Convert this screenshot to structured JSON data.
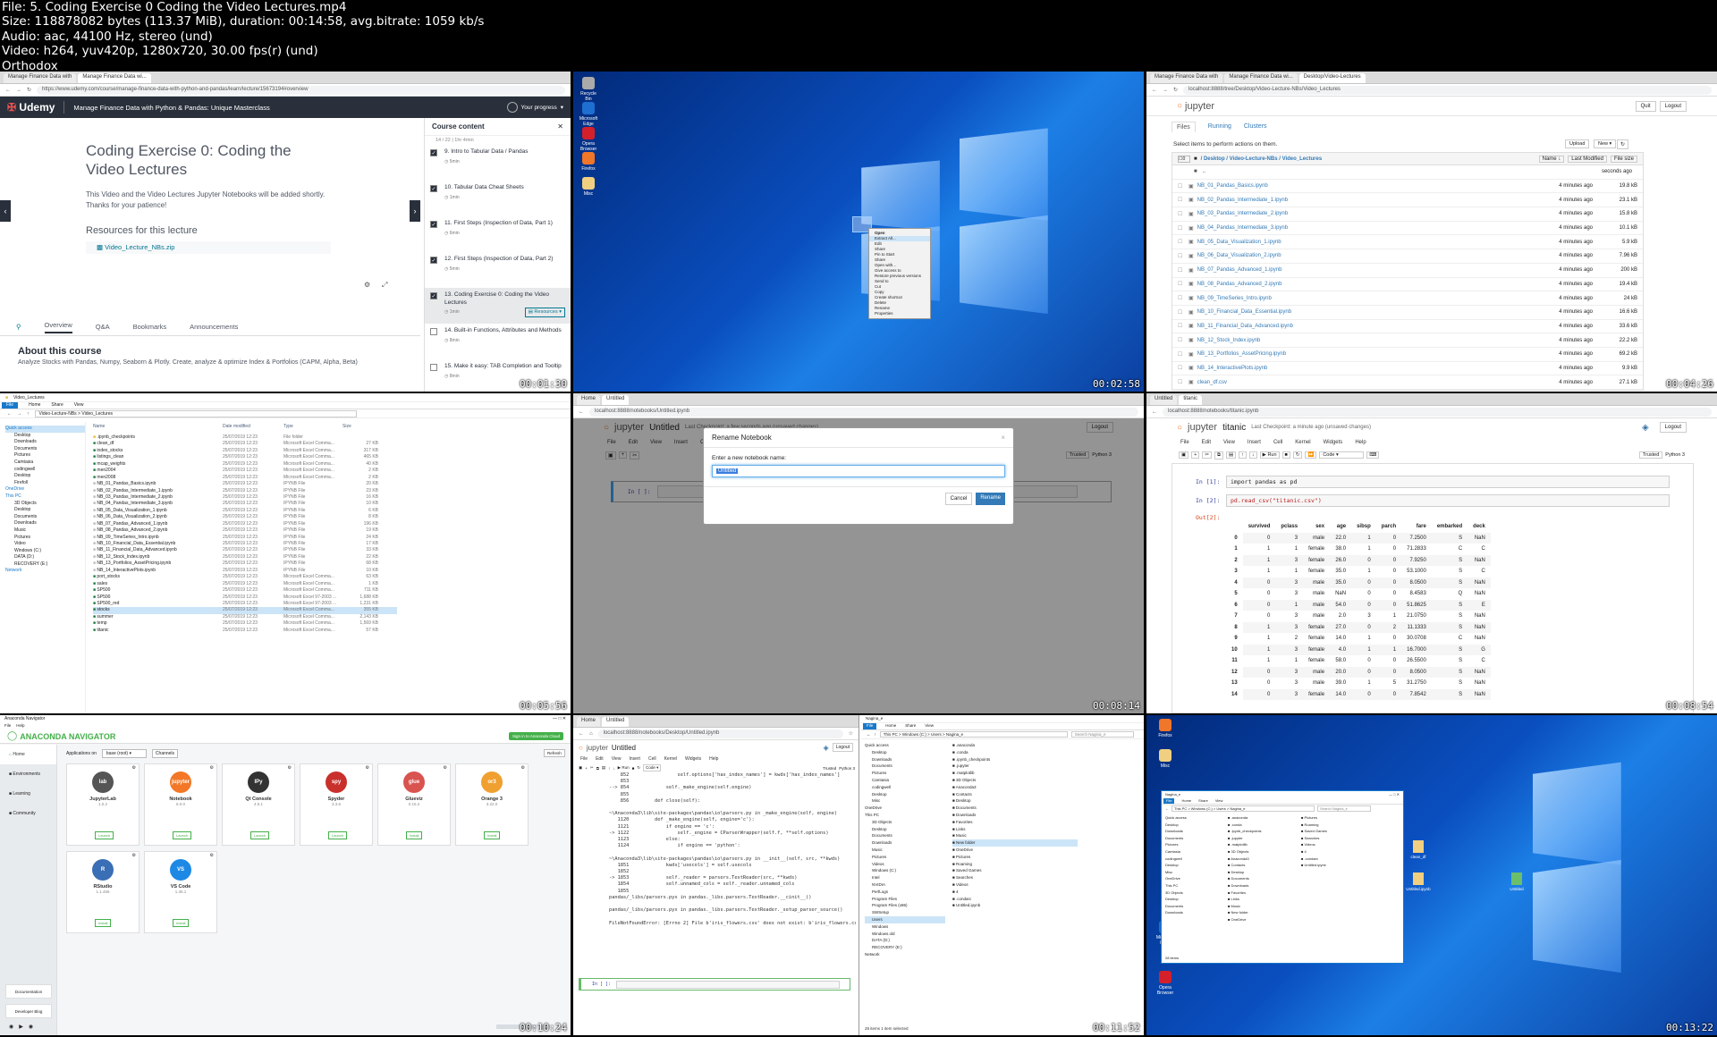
{
  "header": {
    "file": "File: 5. Coding Exercise 0 Coding the Video Lectures.mp4",
    "size": "Size: 118878082 bytes (113.37 MiB), duration: 00:14:58, avg.bitrate: 1059 kb/s",
    "audio": "Audio: aac, 44100 Hz, stereo (und)",
    "video": "Video: h264, yuv420p, 1280x720, 30.00 fps(r) (und)",
    "label": "Orthodox"
  },
  "timestamps": [
    "00:01:30",
    "00:02:58",
    "00:04:26",
    "00:05:56",
    "00:08:14",
    "00:08:54",
    "00:10:24",
    "00:11:52",
    "00:13:22"
  ],
  "udemy": {
    "tab1": "Manage Finance Data with",
    "tab2": "Manage Finance Data wi...",
    "url": "https://www.udemy.com/course/manage-finance-data-with-python-and-pandas/learn/lecture/15673194#overview",
    "logo": "Udemy",
    "course_title": "Manage Finance Data with Python & Pandas: Unique Masterclass",
    "progress": "Your progress",
    "lecture_title": "Coding Exercise 0: Coding the Video Lectures",
    "lecture_body": "This Video and the Video Lectures Jupyter Notebooks will be added shortly. Thanks for your patience!",
    "resources_heading": "Resources for this lecture",
    "resource_file": "Video_Lecture_NBs.zip",
    "tabs": [
      "Overview",
      "Q&A",
      "Bookmarks",
      "Announcements"
    ],
    "about_heading": "About this course",
    "about_body": "Analyze Stocks with Pandas, Numpy, Seaborn & Plotly. Create, analyze & optimize Index & Portfolios (CAPM, Alpha, Beta)",
    "sidebar_title": "Course content",
    "sidebar_top": "14 / 22 | 1hr 4min",
    "items": [
      {
        "label": "9. Intro to Tabular Data / Pandas",
        "dur": "5min",
        "checked": true
      },
      {
        "label": "10. Tabular Data Cheat Sheets",
        "dur": "1min",
        "checked": true
      },
      {
        "label": "11. First Steps (Inspection of Data, Part 1)",
        "dur": "6min",
        "checked": true
      },
      {
        "label": "12. First Steps (Inspection of Data, Part 2)",
        "dur": "5min",
        "checked": true
      },
      {
        "label": "13. Coding Exercise 0: Coding the Video Lectures",
        "dur": "1min",
        "checked": true
      },
      {
        "label": "14. Built-in Functions, Attributes and Methods",
        "dur": "8min",
        "checked": false
      },
      {
        "label": "15. Make it easy: TAB Completion and Tooltip",
        "dur": "8min",
        "checked": false
      }
    ],
    "resources_btn": "Resources"
  },
  "desktop1": {
    "icons": [
      "Recycle Bin",
      "Microsoft Edge",
      "Opera Browser",
      "Firefox",
      "Misc"
    ],
    "menu": [
      "Open",
      "Extract All...",
      "Edit",
      "Share",
      "Pin to Start",
      "Share",
      "Open with...",
      "Give access to",
      "Restore previous versions",
      "Send to",
      "Cut",
      "Copy",
      "Create shortcut",
      "Delete",
      "Rename",
      "Properties"
    ]
  },
  "jupyter_tree": {
    "tab": "Desktop/Video-Lectures",
    "url": "localhost:8888/tree/Desktop/Video-Lecture-NBs/Video_Lectures",
    "logo": "jupyter",
    "quit": "Quit",
    "logout": "Logout",
    "tabs": [
      "Files",
      "Running",
      "Clusters"
    ],
    "instructions": "Select items to perform actions on them.",
    "upload": "Upload",
    "new": "New",
    "breadcrumb": [
      "Desktop",
      "Video-Lecture-NBs",
      "Video_Lectures"
    ],
    "name_col": "Name",
    "modified_col": "Last Modified",
    "size_col": "File size",
    "parent": "..",
    "parent_time": "seconds ago",
    "files": [
      {
        "name": "NB_01_Pandas_Basics.ipynb",
        "time": "4 minutes ago",
        "size": "19.8 kB"
      },
      {
        "name": "NB_02_Pandas_Intermediate_1.ipynb",
        "time": "4 minutes ago",
        "size": "23.1 kB"
      },
      {
        "name": "NB_03_Pandas_Intermediate_2.ipynb",
        "time": "4 minutes ago",
        "size": "15.8 kB"
      },
      {
        "name": "NB_04_Pandas_Intermediate_3.ipynb",
        "time": "4 minutes ago",
        "size": "10.1 kB"
      },
      {
        "name": "NB_05_Data_Visualization_1.ipynb",
        "time": "4 minutes ago",
        "size": "5.9 kB"
      },
      {
        "name": "NB_06_Data_Visualization_2.ipynb",
        "time": "4 minutes ago",
        "size": "7.96 kB"
      },
      {
        "name": "NB_07_Pandas_Advanced_1.ipynb",
        "time": "4 minutes ago",
        "size": "200 kB"
      },
      {
        "name": "NB_08_Pandas_Advanced_2.ipynb",
        "time": "4 minutes ago",
        "size": "19.4 kB"
      },
      {
        "name": "NB_09_TimeSeries_Intro.ipynb",
        "time": "4 minutes ago",
        "size": "24 kB"
      },
      {
        "name": "NB_10_Financial_Data_Essential.ipynb",
        "time": "4 minutes ago",
        "size": "16.6 kB"
      },
      {
        "name": "NB_11_Financial_Data_Advanced.ipynb",
        "time": "4 minutes ago",
        "size": "33.6 kB"
      },
      {
        "name": "NB_12_Stock_Index.ipynb",
        "time": "4 minutes ago",
        "size": "22.2 kB"
      },
      {
        "name": "NB_13_Portfolios_AssetPricing.ipynb",
        "time": "4 minutes ago",
        "size": "69.2 kB"
      },
      {
        "name": "NB_14_InteractivePlots.ipynb",
        "time": "4 minutes ago",
        "size": "9.9 kB"
      },
      {
        "name": "clean_df.csv",
        "time": "4 minutes ago",
        "size": "27.1 kB"
      }
    ]
  },
  "explorer": {
    "title": "Video_Lectures",
    "menu": [
      "File",
      "Home",
      "Share",
      "View"
    ],
    "path": "Video-Lecture-NBs > Video_Lectures",
    "cols": [
      "Name",
      "Date modified",
      "Type",
      "Size"
    ],
    "nav": [
      "Quick access",
      "Desktop",
      "Downloads",
      "Documents",
      "Pictures",
      "Camtasia",
      "codingwell",
      "Desktop",
      "Firefoll",
      "OneDrive",
      "This PC",
      "3D Objects",
      "Desktop",
      "Documents",
      "Downloads",
      "Music",
      "Pictures",
      "Video",
      "Windows (C:)",
      "DATA (D:)",
      "RECOVERY (E:)",
      "Network"
    ],
    "rows": [
      {
        "n": ".ipynb_checkpoints",
        "d": "25/07/2019 12:23",
        "t": "File folder",
        "s": ""
      },
      {
        "n": "clean_df",
        "d": "25/07/2019 12:23",
        "t": "Microsoft Excel Comma...",
        "s": "27 KB"
      },
      {
        "n": "index_stocks",
        "d": "25/07/2019 12:23",
        "t": "Microsoft Excel Comma...",
        "s": "317 KB"
      },
      {
        "n": "listings_clean",
        "d": "25/07/2019 12:23",
        "t": "Microsoft Excel Comma...",
        "s": "465 KB"
      },
      {
        "n": "mcap_weights",
        "d": "25/07/2019 12:23",
        "t": "Microsoft Excel Comma...",
        "s": "40 KB"
      },
      {
        "n": "men2004",
        "d": "25/07/2019 12:23",
        "t": "Microsoft Excel Comma...",
        "s": "2 KB"
      },
      {
        "n": "men2008",
        "d": "25/07/2019 12:23",
        "t": "Microsoft Excel Comma...",
        "s": "2 KB"
      },
      {
        "n": "NB_01_Pandas_Basics.ipynb",
        "d": "25/07/2019 12:23",
        "t": "IPYNB File",
        "s": "20 KB"
      },
      {
        "n": "NB_02_Pandas_Intermediate_1.ipynb",
        "d": "25/07/2019 12:23",
        "t": "IPYNB File",
        "s": "23 KB"
      },
      {
        "n": "NB_03_Pandas_Intermediate_2.ipynb",
        "d": "25/07/2019 12:23",
        "t": "IPYNB File",
        "s": "16 KB"
      },
      {
        "n": "NB_04_Pandas_Intermediate_3.ipynb",
        "d": "25/07/2019 12:23",
        "t": "IPYNB File",
        "s": "10 KB"
      },
      {
        "n": "NB_05_Data_Visualization_1.ipynb",
        "d": "25/07/2019 12:23",
        "t": "IPYNB File",
        "s": "6 KB"
      },
      {
        "n": "NB_06_Data_Visualization_2.ipynb",
        "d": "25/07/2019 12:23",
        "t": "IPYNB File",
        "s": "8 KB"
      },
      {
        "n": "NB_07_Pandas_Advanced_1.ipynb",
        "d": "25/07/2019 12:23",
        "t": "IPYNB File",
        "s": "196 KB"
      },
      {
        "n": "NB_08_Pandas_Advanced_2.ipynb",
        "d": "25/07/2019 12:23",
        "t": "IPYNB File",
        "s": "19 KB"
      },
      {
        "n": "NB_09_TimeSeries_Intro.ipynb",
        "d": "25/07/2019 12:23",
        "t": "IPYNB File",
        "s": "24 KB"
      },
      {
        "n": "NB_10_Financial_Data_Essential.ipynb",
        "d": "25/07/2019 12:23",
        "t": "IPYNB File",
        "s": "17 KB"
      },
      {
        "n": "NB_11_Financial_Data_Advanced.ipynb",
        "d": "25/07/2019 12:23",
        "t": "IPYNB File",
        "s": "33 KB"
      },
      {
        "n": "NB_12_Stock_Index.ipynb",
        "d": "25/07/2019 12:23",
        "t": "IPYNB File",
        "s": "22 KB"
      },
      {
        "n": "NB_13_Portfolios_AssetPricing.ipynb",
        "d": "25/07/2019 12:23",
        "t": "IPYNB File",
        "s": "68 KB"
      },
      {
        "n": "NB_14_InteractivePlots.ipynb",
        "d": "25/07/2019 12:23",
        "t": "IPYNB File",
        "s": "10 KB"
      },
      {
        "n": "port_stocks",
        "d": "25/07/2019 12:23",
        "t": "Microsoft Excel Comma...",
        "s": "63 KB"
      },
      {
        "n": "sales",
        "d": "25/07/2019 12:23",
        "t": "Microsoft Excel Comma...",
        "s": "1 KB"
      },
      {
        "n": "SP500",
        "d": "25/07/2019 12:23",
        "t": "Microsoft Excel Comma...",
        "s": "711 KB"
      },
      {
        "n": "SP500",
        "d": "25/07/2019 12:23",
        "t": "Microsoft Excel 97-2003 ...",
        "s": "1,688 KB"
      },
      {
        "n": "SP500_red",
        "d": "25/07/2019 12:23",
        "t": "Microsoft Excel 97-2003 ...",
        "s": "1,231 KB"
      },
      {
        "n": "stocks",
        "d": "25/07/2019 12:23",
        "t": "Microsoft Excel Comma...",
        "s": "355 KB"
      },
      {
        "n": "summer",
        "d": "25/07/2019 12:23",
        "t": "Microsoft Excel Comma...",
        "s": "2,143 KB"
      },
      {
        "n": "temp",
        "d": "25/07/2019 12:23",
        "t": "Microsoft Excel Comma...",
        "s": "1,569 KB"
      },
      {
        "n": "titanic",
        "d": "25/07/2019 12:23",
        "t": "Microsoft Excel Comma...",
        "s": "57 KB"
      }
    ]
  },
  "rename": {
    "tab1": "Untitled",
    "tab2": "Home",
    "logo": "jupyter",
    "nb_name": "Untitled",
    "checkpoint": "Last Checkpoint: a few seconds ago (unsaved changes)",
    "logout": "Logout",
    "menu": [
      "File",
      "Edit",
      "View",
      "Insert",
      "Cell",
      "Kernel",
      "Widgets",
      "Help"
    ],
    "trusted": "Trusted",
    "kernel": "Python 3",
    "prompt": "In [ ]:",
    "dialog_title": "Rename Notebook",
    "dialog_label": "Enter a new notebook name:",
    "dialog_value": "Untitled",
    "cancel": "Cancel",
    "rename": "Rename"
  },
  "titanic_nb": {
    "tab1": "Untitled",
    "tab2": "titanic",
    "logo": "jupyter",
    "nb_name": "titanic",
    "checkpoint": "Last Checkpoint: a minute ago (unsaved changes)",
    "logout": "Logout",
    "menu": [
      "File",
      "Edit",
      "View",
      "Insert",
      "Cell",
      "Kernel",
      "Widgets",
      "Help"
    ],
    "trusted": "Trusted",
    "kernel": "Python 3",
    "run": "Run",
    "celltype": "Code",
    "in1": "In [1]:",
    "code1": "import pandas as pd",
    "in2": "In [2]:",
    "code2": "pd.read_csv(\"titanic.csv\")",
    "out2": "Out[2]:",
    "columns": [
      "survived",
      "pclass",
      "sex",
      "age",
      "sibsp",
      "parch",
      "fare",
      "embarked",
      "deck"
    ],
    "rows": [
      [
        "0",
        "0",
        "3",
        "male",
        "22.0",
        "1",
        "0",
        "7.2500",
        "S",
        "NaN"
      ],
      [
        "1",
        "1",
        "1",
        "female",
        "38.0",
        "1",
        "0",
        "71.2833",
        "C",
        "C"
      ],
      [
        "2",
        "1",
        "3",
        "female",
        "26.0",
        "0",
        "0",
        "7.9250",
        "S",
        "NaN"
      ],
      [
        "3",
        "1",
        "1",
        "female",
        "35.0",
        "1",
        "0",
        "53.1000",
        "S",
        "C"
      ],
      [
        "4",
        "0",
        "3",
        "male",
        "35.0",
        "0",
        "0",
        "8.0500",
        "S",
        "NaN"
      ],
      [
        "5",
        "0",
        "3",
        "male",
        "NaN",
        "0",
        "0",
        "8.4583",
        "Q",
        "NaN"
      ],
      [
        "6",
        "0",
        "1",
        "male",
        "54.0",
        "0",
        "0",
        "51.8625",
        "S",
        "E"
      ],
      [
        "7",
        "0",
        "3",
        "male",
        "2.0",
        "3",
        "1",
        "21.0750",
        "S",
        "NaN"
      ],
      [
        "8",
        "1",
        "3",
        "female",
        "27.0",
        "0",
        "2",
        "11.1333",
        "S",
        "NaN"
      ],
      [
        "9",
        "1",
        "2",
        "female",
        "14.0",
        "1",
        "0",
        "30.0708",
        "C",
        "NaN"
      ],
      [
        "10",
        "1",
        "3",
        "female",
        "4.0",
        "1",
        "1",
        "16.7000",
        "S",
        "G"
      ],
      [
        "11",
        "1",
        "1",
        "female",
        "58.0",
        "0",
        "0",
        "26.5500",
        "S",
        "C"
      ],
      [
        "12",
        "0",
        "3",
        "male",
        "20.0",
        "0",
        "0",
        "8.0500",
        "S",
        "NaN"
      ],
      [
        "13",
        "0",
        "3",
        "male",
        "39.0",
        "1",
        "5",
        "31.2750",
        "S",
        "NaN"
      ],
      [
        "14",
        "0",
        "3",
        "female",
        "14.0",
        "0",
        "0",
        "7.8542",
        "S",
        "NaN"
      ]
    ]
  },
  "anaconda": {
    "title": "Anaconda Navigator",
    "menu": [
      "File",
      "Help"
    ],
    "logo": "ANACONDA NAVIGATOR",
    "signin": "Sign in to Anaconda Cloud",
    "nav": [
      "Home",
      "Environments",
      "Learning",
      "Community"
    ],
    "apps_on": "Applications on",
    "env": "base (root)",
    "channels": "Channels",
    "refresh": "Refresh",
    "cards": [
      {
        "name": "JupyterLab",
        "ver": "1.0.2",
        "btn": "Launch",
        "mark": "lab"
      },
      {
        "name": "Notebook",
        "ver": "6.0.0",
        "btn": "Launch",
        "mark": "jupyter"
      },
      {
        "name": "Qt Console",
        "ver": "4.5.1",
        "btn": "Launch",
        "mark": "IPy"
      },
      {
        "name": "Spyder",
        "ver": "3.3.6",
        "btn": "Launch",
        "mark": "spy"
      },
      {
        "name": "Glueviz",
        "ver": "0.15.2",
        "btn": "Install",
        "mark": "glue"
      },
      {
        "name": "Orange 3",
        "ver": "3.22.0",
        "btn": "Install",
        "mark": "or3"
      },
      {
        "name": "RStudio",
        "ver": "1.1.456",
        "btn": "Install",
        "mark": "R"
      },
      {
        "name": "VS Code",
        "ver": "1.36.1",
        "btn": "Install",
        "mark": "VS"
      }
    ],
    "side_links": [
      "Documentation",
      "Developer Blog"
    ]
  },
  "error_nb": {
    "tab1": "Home",
    "tab2": "Untitled",
    "url": "localhost:8888/notebooks/Desktop/Untitled.ipynb",
    "logo": "jupyter",
    "nb_name": "Untitled",
    "logout": "Logout",
    "trusted": "Trusted",
    "kernel": "Python 3",
    "run": "Run",
    "celltype": "Code",
    "traceback": "    852                 self.options['has_index_names'] = kwds['has_index_names']\n    853 \n--> 854             self._make_engine(self.engine)\n    855 \n    856         def close(self):\n\n~\\Anaconda3\\lib\\site-packages\\pandas\\io\\parsers.py in _make_engine(self, engine)\n   1120         def _make_engine(self, engine='c'):\n   1121             if engine == 'c':\n-> 1122                 self._engine = CParserWrapper(self.f, **self.options)\n   1123             else:\n   1124                 if engine == 'python':\n\n~\\Anaconda3\\lib\\site-packages\\pandas\\io\\parsers.py in __init__(self, src, **kwds)\n   1851             kwds['usecols'] = self.usecols\n   1852 \n-> 1853             self._reader = parsers.TextReader(src, **kwds)\n   1854             self.unnamed_cols = self._reader.unnamed_cols\n   1855 \npandas/_libs/parsers.pyx in pandas._libs.parsers.TextReader.__cinit__()\n\npandas/_libs/parsers.pyx in pandas._libs.parsers.TextReader._setup_parser_source()\n\nFileNotFoundError: [Errno 2] File b'iris_flowers.csv' does not exist: b'iris_flowers.csv'",
    "prompt": "In [ ]:"
  },
  "explorer2": {
    "title": "Nagina_e",
    "menu": [
      "File",
      "Home",
      "Share",
      "View"
    ],
    "path": "This PC > Windows (C:) > Users > Nagina_e",
    "search": "Search Nagina_e",
    "nav": [
      "Quick access",
      "Desktop",
      "Downloads",
      "Documents",
      "Pictures",
      "Camtasia",
      "codingwell",
      "Desktop",
      "Misc",
      "OneDrive",
      "This PC",
      "3D Objects",
      "Desktop",
      "Documents",
      "Downloads",
      "Music",
      "Pictures",
      "Videos",
      "Windows (C:)",
      "Intel",
      "NVIDIA",
      "PerfLogs",
      "Program Files",
      "Program Files (x86)",
      "SWSetup",
      "Users",
      "Windows",
      "Windows.old",
      "DATA (D:)",
      "RECOVERY (E:)",
      "Network"
    ],
    "col2": [
      ".anaconda",
      ".conda",
      ".ipynb_checkpoints",
      ".jupyter",
      ".matplotlib",
      "3D Objects",
      "Anaconda3",
      "Contacts",
      "Desktop",
      "Documents",
      "Downloads",
      "Favorites",
      "Links",
      "Music",
      "New folder",
      "OneDrive",
      "Pictures",
      "Roaming",
      "Saved Games",
      "Searches",
      "Videos",
      "4",
      ".condarc",
      "Untitled.ipynb"
    ],
    "status": "28 items    1 item selected"
  },
  "desktop2": {
    "icons": [
      "Firefox",
      "Misc",
      "Microsoft Edge",
      "Opera Browser"
    ],
    "window_title": "Nagina_e",
    "path": "This PC > Windows (C:) > Users > Nagina_e",
    "search": "Search Nagina_e",
    "colA": [
      ".anaconda",
      ".conda",
      ".ipynb_checkpoints",
      ".jupyter",
      ".matplotlib",
      "3D Objects",
      "Anaconda3",
      "Contacts",
      "Desktop",
      "Documents",
      "Downloads",
      "Favorites",
      "Links",
      "Music",
      "New folder",
      "OneDrive"
    ],
    "colB": [
      "Pictures",
      "Roaming",
      "Saved Games",
      "Searches",
      "Videos",
      "4",
      ".condarc",
      "Untitled.ipynb"
    ],
    "nav": [
      "Quick access",
      "Desktop",
      "Downloads",
      "Documents",
      "Pictures",
      "Camtasia",
      "codingwell",
      "Desktop",
      "Misc",
      "OneDrive",
      "This PC",
      "3D Objects",
      "Desktop",
      "Documents",
      "Downloads"
    ],
    "status": "28 items",
    "files_on_desktop": [
      "clean_df",
      "Untitled.ipynb",
      "Untitled"
    ]
  },
  "colors": {
    "udemy_dark": "#29303b",
    "udemy_purple": "#a435f0",
    "jupyter_orange": "#f37726",
    "link": "#296eaa",
    "anaconda_green": "#43b049",
    "win_blue": "#0a4fc0"
  }
}
